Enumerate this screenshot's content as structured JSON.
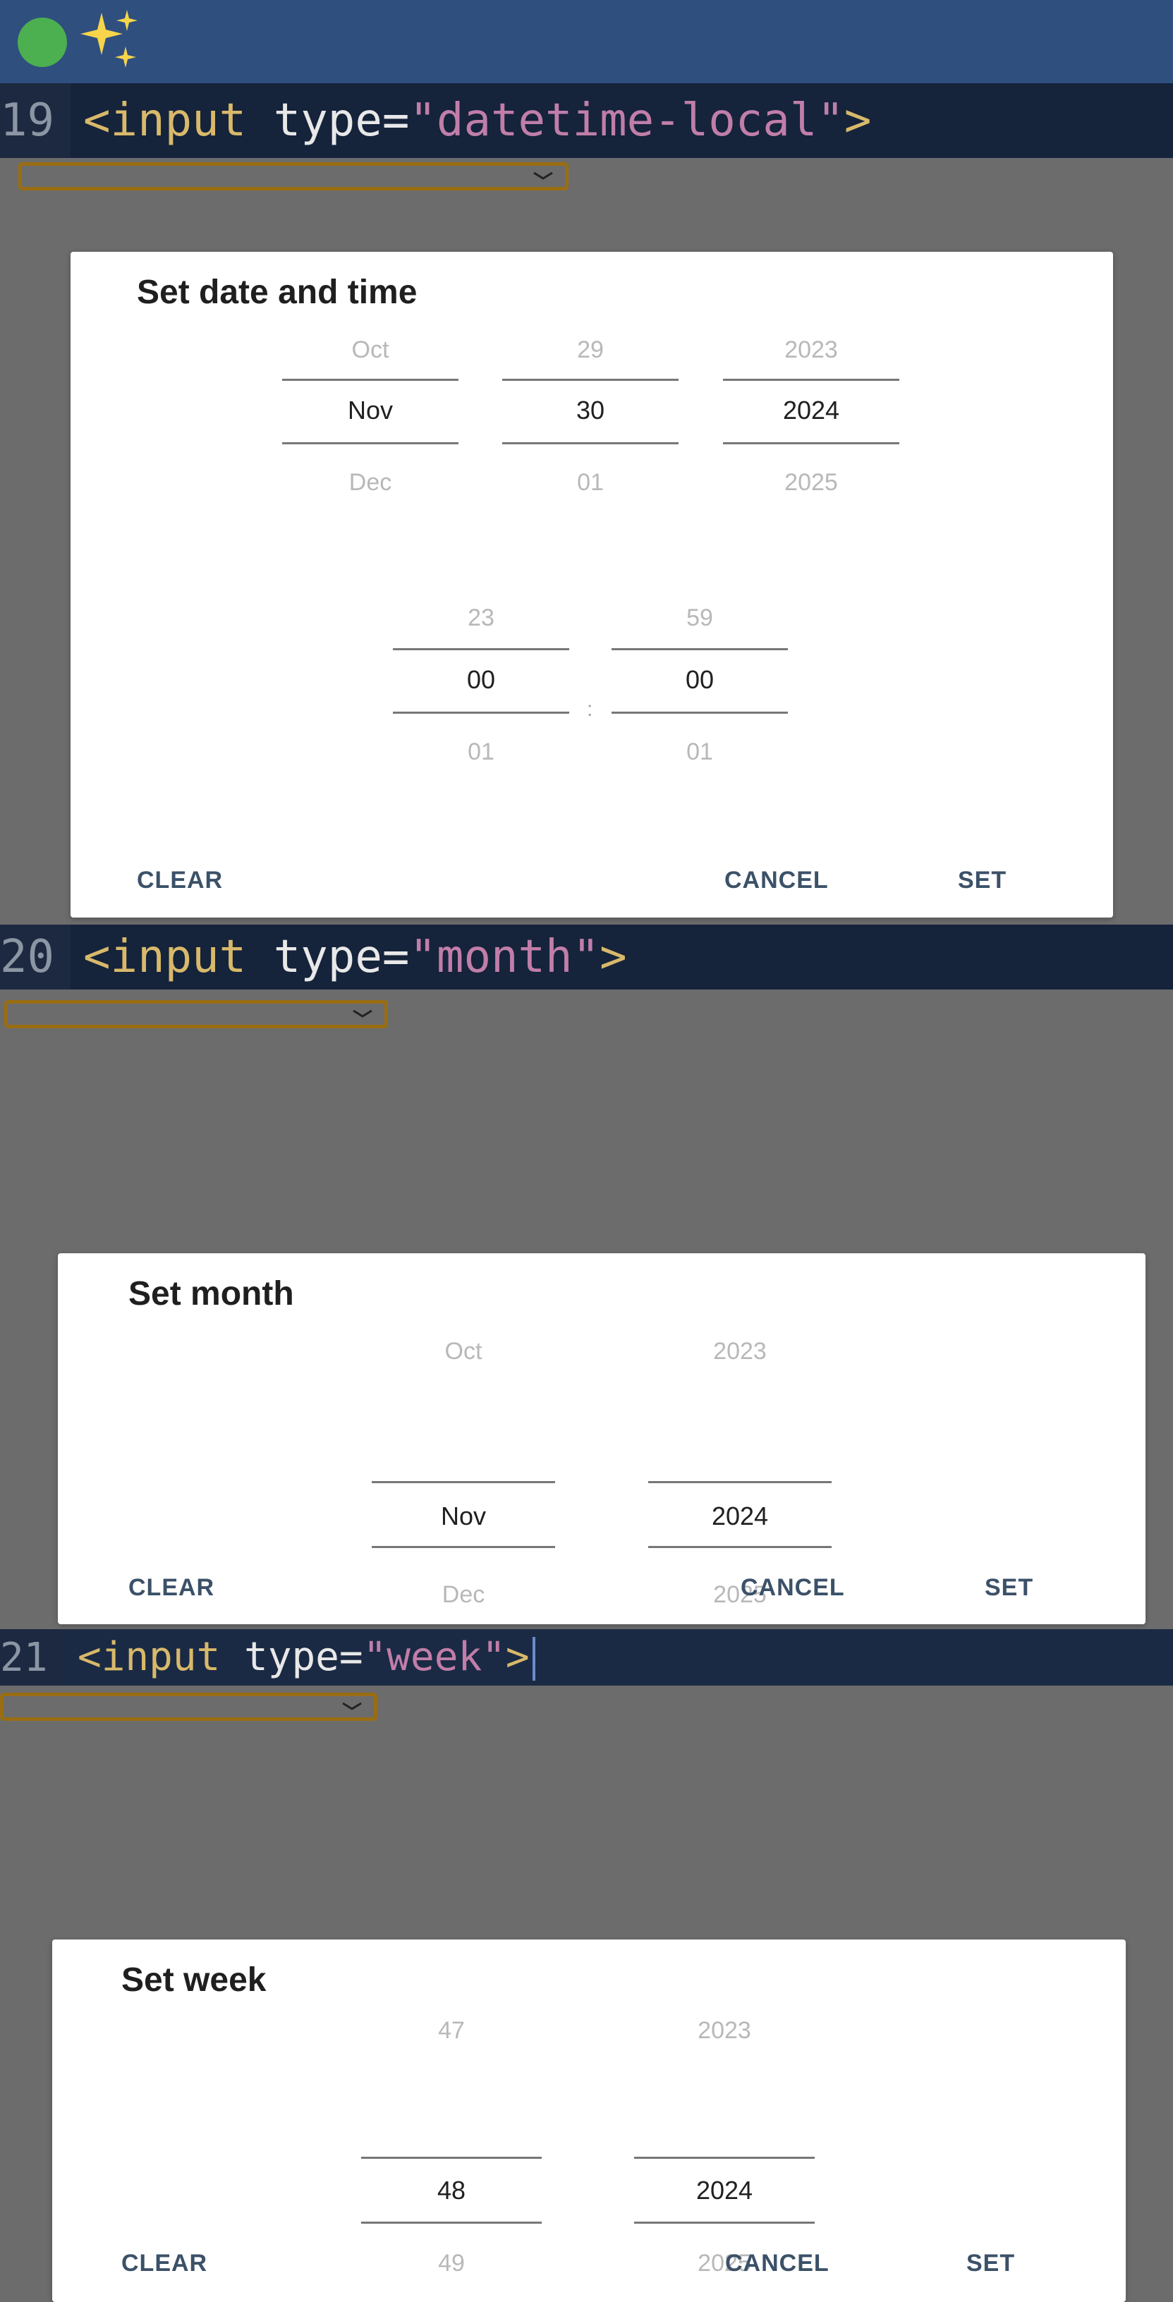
{
  "header": {
    "sparkle_icon": "sparkles-icon",
    "status_color": "#4caf50"
  },
  "code_lines": [
    {
      "line_number": "19",
      "tag_open": "<input",
      "attr": "type",
      "eq": "=",
      "value": "\"datetime-local\"",
      "tag_close": ">"
    },
    {
      "line_number": "20",
      "tag_open": "<input",
      "attr": "type",
      "eq": "=",
      "value": "\"month\"",
      "tag_close": ">"
    },
    {
      "line_number": "21",
      "tag_open": "<input",
      "attr": "type",
      "eq": "=",
      "value": "\"week\"",
      "tag_close": ">"
    }
  ],
  "dialogs": {
    "datetime": {
      "title": "Set date and time",
      "month": {
        "prev": "Oct",
        "current": "Nov",
        "next": "Dec"
      },
      "day": {
        "prev": "29",
        "current": "30",
        "next": "01"
      },
      "year": {
        "prev": "2023",
        "current": "2024",
        "next": "2025"
      },
      "hour": {
        "prev": "23",
        "current": "00",
        "next": "01"
      },
      "minute": {
        "prev": "59",
        "current": "00",
        "next": "01"
      },
      "colon": ":",
      "clear": "CLEAR",
      "cancel": "CANCEL",
      "set": "SET"
    },
    "month": {
      "title": "Set month",
      "month": {
        "prev": "Oct",
        "current": "Nov",
        "next": "Dec"
      },
      "year": {
        "prev": "2023",
        "current": "2024",
        "next": "2025"
      },
      "clear": "CLEAR",
      "cancel": "CANCEL",
      "set": "SET"
    },
    "week": {
      "title": "Set week",
      "week": {
        "prev": "47",
        "current": "48",
        "next": "49"
      },
      "year": {
        "prev": "2023",
        "current": "2024",
        "next": "2025"
      },
      "clear": "CLEAR",
      "cancel": "CANCEL",
      "set": "SET"
    }
  },
  "colors": {
    "select_border": "#9a6d12",
    "button_text": "#3b5168",
    "backdrop": "#6c6c6c"
  }
}
